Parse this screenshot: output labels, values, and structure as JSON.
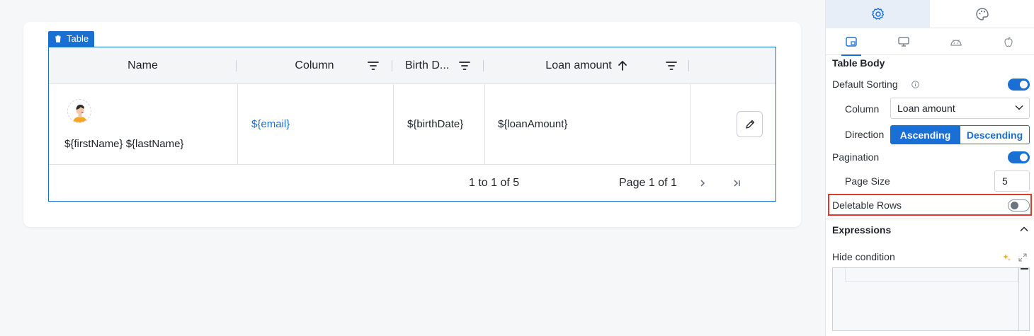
{
  "canvas": {
    "table_tag": "Table",
    "columns": [
      {
        "label": "Name"
      },
      {
        "label": "Column"
      },
      {
        "label": "Birth D..."
      },
      {
        "label": "Loan amount"
      }
    ],
    "row": {
      "name": "${firstName} ${lastName}",
      "email": "${email}",
      "birth": "${birthDate}",
      "loan": "${loanAmount}"
    },
    "pager": {
      "range": "1 to 1 of 5",
      "page": "Page 1 of 1"
    }
  },
  "panel": {
    "section_title": "Table Body",
    "default_sorting_label": "Default Sorting",
    "column_label": "Column",
    "column_value": "Loan amount",
    "direction_label": "Direction",
    "ascending": "Ascending",
    "descending": "Descending",
    "pagination_label": "Pagination",
    "page_size_label": "Page Size",
    "page_size_value": "5",
    "deletable_rows_label": "Deletable Rows",
    "expressions_label": "Expressions",
    "hide_condition_label": "Hide condition"
  },
  "colors": {
    "accent": "#1a6fd4",
    "highlight": "#e0382b"
  }
}
